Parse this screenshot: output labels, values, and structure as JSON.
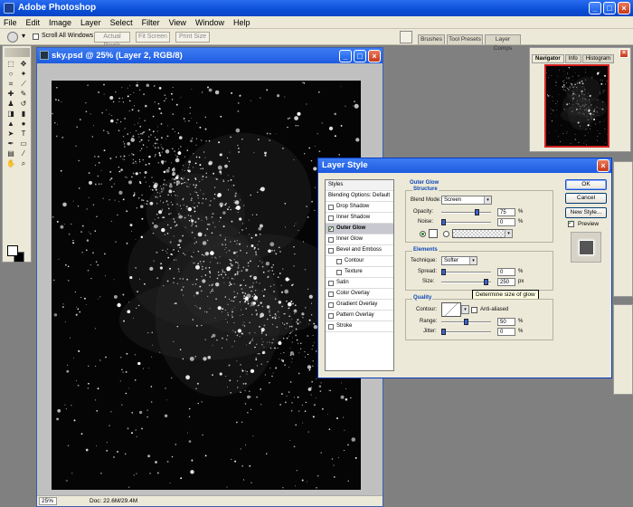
{
  "app": {
    "title": "Adobe Photoshop"
  },
  "menu": [
    "File",
    "Edit",
    "Image",
    "Layer",
    "Select",
    "Filter",
    "View",
    "Window",
    "Help"
  ],
  "options": {
    "scroll_all_label": "Scroll All Windows",
    "actual_pixels": "Actual Pixels",
    "fit_screen": "Fit Screen",
    "print_size": "Print Size",
    "palette_tabs": [
      "Brushes",
      "Tool Presets",
      "Layer Comps"
    ]
  },
  "document": {
    "title": "sky.psd @ 25% (Layer 2, RGB/8)",
    "zoom": "25%",
    "doc_size": "Doc: 22.6M/29.4M"
  },
  "navigator": {
    "tabs": [
      "Navigator",
      "Info",
      "Histogram"
    ]
  },
  "dialog": {
    "title": "Layer Style",
    "styles_header": "Styles",
    "styles_list": [
      {
        "label": "Blending Options: Default",
        "checkbox": false,
        "checked": false,
        "indent": false,
        "selected": false
      },
      {
        "label": "Drop Shadow",
        "checkbox": true,
        "checked": false,
        "indent": false,
        "selected": false
      },
      {
        "label": "Inner Shadow",
        "checkbox": true,
        "checked": false,
        "indent": false,
        "selected": false
      },
      {
        "label": "Outer Glow",
        "checkbox": true,
        "checked": true,
        "indent": false,
        "selected": true
      },
      {
        "label": "Inner Glow",
        "checkbox": true,
        "checked": false,
        "indent": false,
        "selected": false
      },
      {
        "label": "Bevel and Emboss",
        "checkbox": true,
        "checked": false,
        "indent": false,
        "selected": false
      },
      {
        "label": "Contour",
        "checkbox": true,
        "checked": false,
        "indent": true,
        "selected": false
      },
      {
        "label": "Texture",
        "checkbox": true,
        "checked": false,
        "indent": true,
        "selected": false
      },
      {
        "label": "Satin",
        "checkbox": true,
        "checked": false,
        "indent": false,
        "selected": false
      },
      {
        "label": "Color Overlay",
        "checkbox": true,
        "checked": false,
        "indent": false,
        "selected": false
      },
      {
        "label": "Gradient Overlay",
        "checkbox": true,
        "checked": false,
        "indent": false,
        "selected": false
      },
      {
        "label": "Pattern Overlay",
        "checkbox": true,
        "checked": false,
        "indent": false,
        "selected": false
      },
      {
        "label": "Stroke",
        "checkbox": true,
        "checked": false,
        "indent": false,
        "selected": false
      }
    ],
    "outer_glow": {
      "heading": "Outer Glow",
      "structure": {
        "title": "Structure",
        "blend_mode_label": "Blend Mode:",
        "blend_mode": "Screen",
        "opacity_label": "Opacity:",
        "opacity": "75",
        "opacity_fraction": 0.75,
        "noise_label": "Noise:",
        "noise": "0",
        "noise_fraction": 0.0
      },
      "elements": {
        "title": "Elements",
        "technique_label": "Technique:",
        "technique": "Softer",
        "spread_label": "Spread:",
        "spread": "0",
        "spread_fraction": 0.0,
        "size_label": "Size:",
        "size": "250",
        "size_fraction": 0.95
      },
      "quality": {
        "title": "Quality",
        "contour_label": "Contour:",
        "anti_aliased": "Anti-aliased",
        "range_label": "Range:",
        "range": "50",
        "range_fraction": 0.5,
        "jitter_label": "Jitter:",
        "jitter": "0",
        "jitter_fraction": 0.0
      },
      "tooltip": "Determine size of glow"
    },
    "percent_unit": "%",
    "px_unit": "px",
    "buttons": {
      "ok": "OK",
      "cancel": "Cancel",
      "new_style": "New Style..."
    },
    "preview_label": "Preview"
  }
}
